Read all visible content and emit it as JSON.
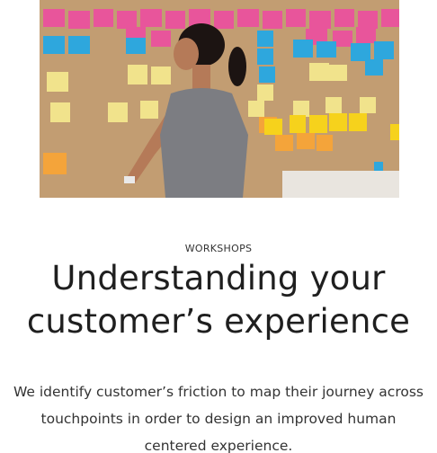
{
  "hero": {
    "image_description": "Person placing sticky notes on a cork wall during a workshop"
  },
  "section": {
    "eyebrow": "WORKSHOPS",
    "title_line1": "Understanding your",
    "title_line2": "customer’s experience",
    "description_line1": "We identify customer’s friction to map their journey across",
    "description_line2": "touchpoints in order to design an improved human",
    "description_line3": "centered experience."
  },
  "colors": {
    "board": "#c9a57a",
    "note_pink": "#e8559b",
    "note_blue": "#2ea7dd",
    "note_yellow": "#f1e38c",
    "note_orange": "#f4a43a",
    "text_dark": "#1f1f1f",
    "text_body": "#333333"
  }
}
